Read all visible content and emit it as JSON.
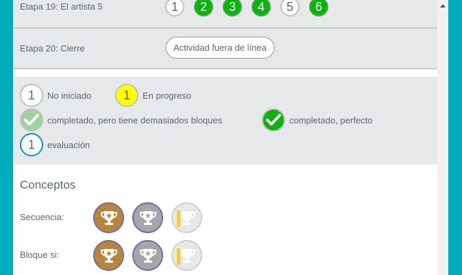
{
  "stages": {
    "stage19": {
      "label": "Etapa 19: El artista 5",
      "bubbles": [
        "1",
        "2",
        "3",
        "4",
        "5",
        "6"
      ]
    },
    "stage20": {
      "label": "Etapa 20: Cierre",
      "button": "Actividad fuera de línea"
    }
  },
  "legend": {
    "not_started": {
      "number": "1",
      "label": "No iniciado"
    },
    "in_progress": {
      "number": "1",
      "label": "En progreso"
    },
    "completed_too_many": {
      "label": "completado, pero tiene demasiados bloques"
    },
    "completed_perfect": {
      "label": "completado, perfecto"
    },
    "assessment": {
      "number": "1",
      "label": "evaluación"
    }
  },
  "concepts": {
    "title": "Conceptos",
    "rows": [
      {
        "label": "Secuencia:"
      },
      {
        "label": "Bloque si:"
      }
    ]
  },
  "colors": {
    "frame": "#00adbc",
    "green": "#0eb20e",
    "light_green": "#9fd29f",
    "yellow": "#ffff00",
    "assessment_blue": "#0094ca",
    "bronze": "#b7853e",
    "silver": "#a4a6a9"
  },
  "icons": [
    "checkmark-icon",
    "trophy-icon",
    "scroll-up-arrow-icon"
  ]
}
